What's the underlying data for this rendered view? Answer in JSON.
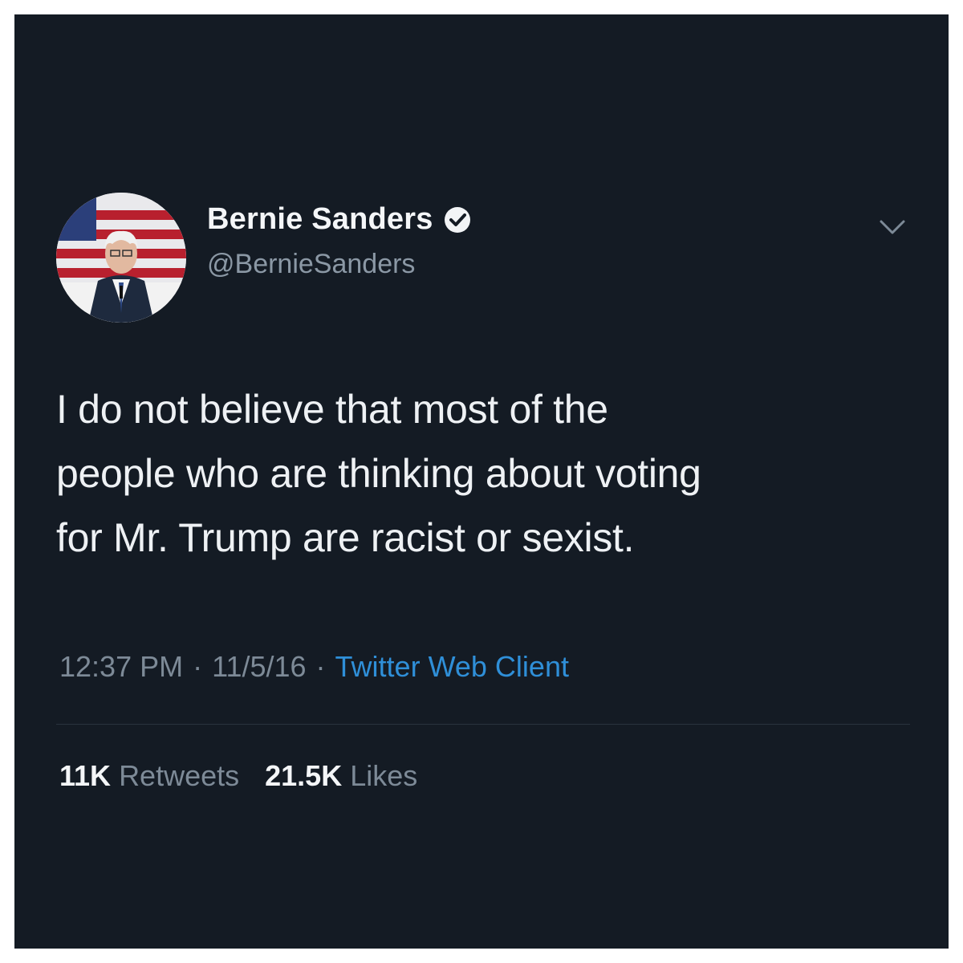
{
  "tweet": {
    "author": {
      "display_name": "Bernie Sanders",
      "handle": "@BernieSanders",
      "verified": true,
      "avatar_icon": "profile-photo"
    },
    "text": "I do not believe that most of the\npeople who are thinking about voting\nfor Mr. Trump are racist or sexist.",
    "time": "12:37 PM",
    "date": "11/5/16",
    "separator": "·",
    "client": "Twitter Web Client",
    "stats": {
      "retweets_count": "11K",
      "retweets_label": "Retweets",
      "likes_count": "21.5K",
      "likes_label": "Likes"
    }
  },
  "colors": {
    "background": "#141b24",
    "text_primary": "#eef1f4",
    "text_secondary": "#7d8a97",
    "link": "#2f8fd8"
  },
  "icons": {
    "verified": "verified-badge-icon",
    "menu": "chevron-down-icon"
  }
}
